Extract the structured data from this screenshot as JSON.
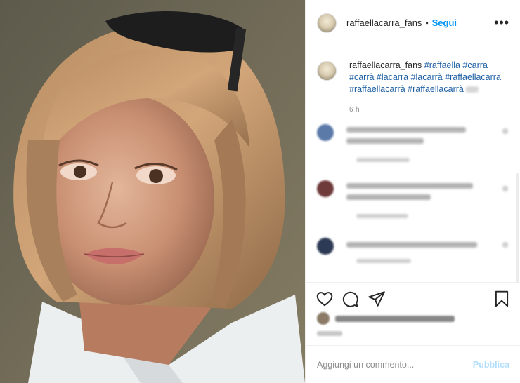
{
  "header": {
    "username": "raffaellacarra_fans",
    "separator": "•",
    "follow_label": "Segui",
    "more_icon": "more-horizontal-icon"
  },
  "caption": {
    "username": "raffaellacarra_fans",
    "hashtags": [
      "#raffaella",
      "#carra",
      "#carrà",
      "#lacarra",
      "#lacarrà",
      "#raffaellacarra",
      "#raffaellacarrà",
      "#raffaellacarrà"
    ],
    "time": "6 h"
  },
  "actions": {
    "like_icon": "heart-icon",
    "comment_icon": "comment-bubble-icon",
    "share_icon": "paper-plane-icon",
    "save_icon": "bookmark-icon"
  },
  "add_comment": {
    "placeholder": "Aggiungi un commento...",
    "publish_label": "Pubblica"
  },
  "colors": {
    "link_blue": "#0095f6",
    "hashtag_blue": "#1d5fa3",
    "publish_disabled": "#b2dffc",
    "border": "#efefef"
  }
}
